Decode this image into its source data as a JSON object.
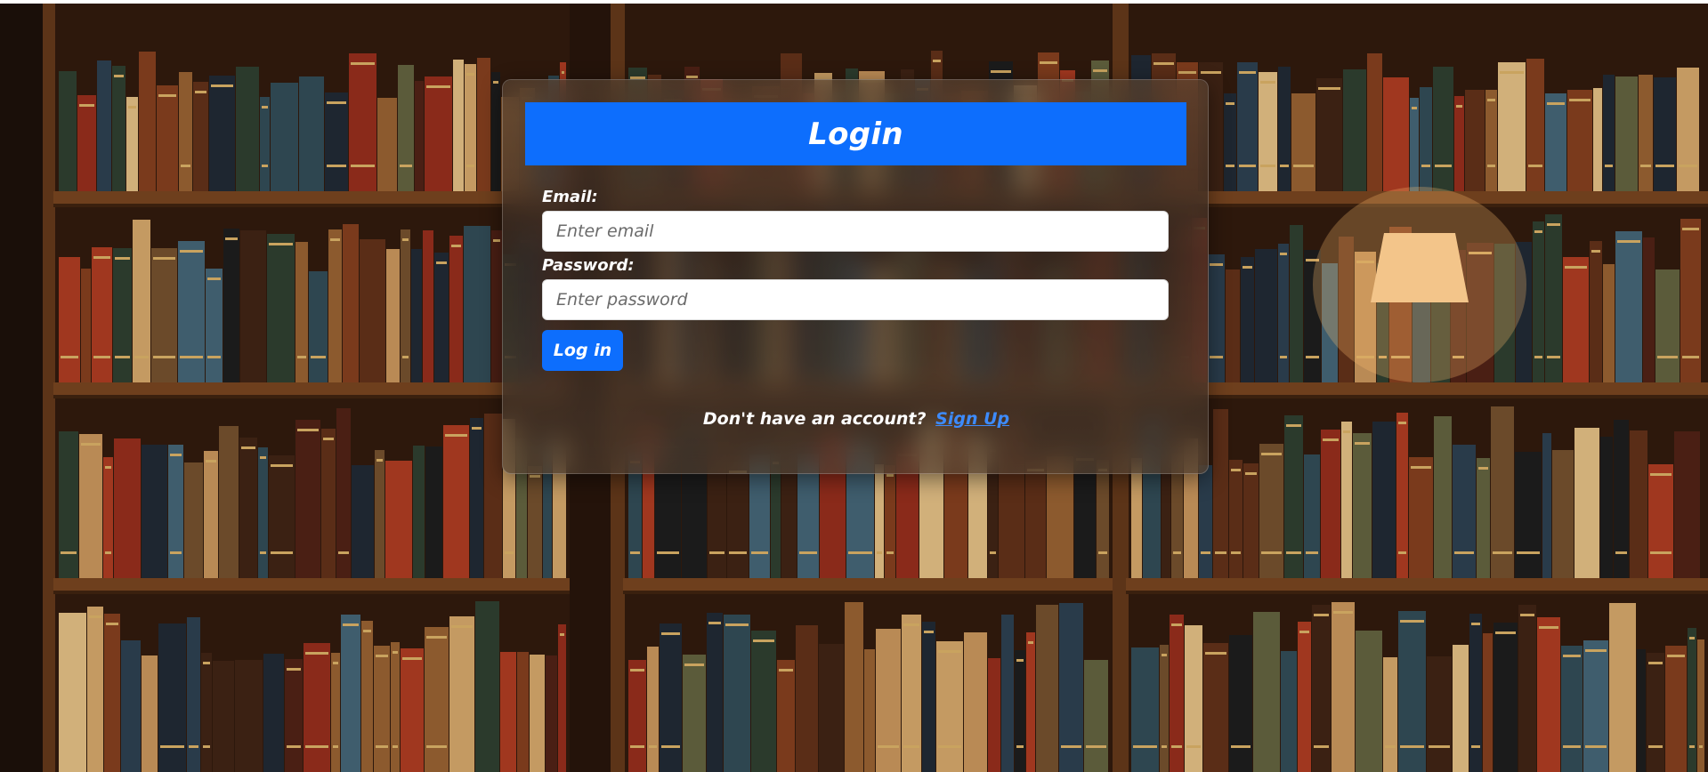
{
  "login": {
    "title": "Login",
    "email_label": "Email:",
    "email_placeholder": "Enter email",
    "password_label": "Password:",
    "password_placeholder": "Enter password",
    "submit_label": "Log in",
    "signup_prompt": "Don't have an account?",
    "signup_link": "Sign Up"
  },
  "colors": {
    "accent": "#0d6efd",
    "link": "#3d8bfd",
    "text": "#ffffff"
  }
}
